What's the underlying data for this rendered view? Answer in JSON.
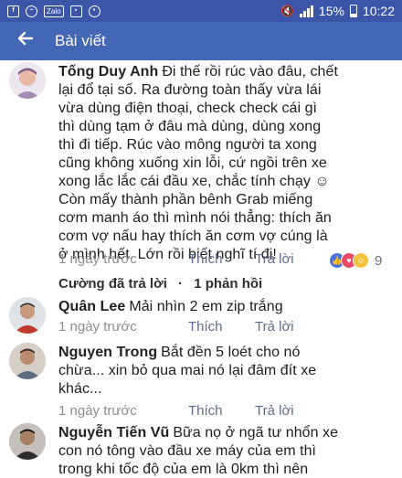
{
  "status": {
    "battery": "15%",
    "time": "10:22",
    "zalo": "Zalo"
  },
  "header": {
    "back_icon": "arrow-left-icon",
    "title": "Bài viết",
    "color": "#4467b5"
  },
  "comments": [
    {
      "author": "Tống Duy Anh",
      "lines": [
        "Đi thế rồi rúc vào đâu, chết",
        "lại đổ tại số. Ra đường toàn thấy vừa lái",
        "vừa dùng điện thoại, check check cái gì",
        "thì dùng tạm ở đâu mà dùng, dùng xong",
        "thì đi tiếp. Rúc vào mông người ta xong",
        "cũng không xuống xin lỗi, cứ ngồi trên xe",
        "xong lắc lắc cái đầu xe, chắc tính chạy ☺",
        "Còn mấy thành phần bênh Grab miếng",
        "cơm manh áo thì mình nói thẳng: thích ăn",
        "cơm vợ nấu hay thích ăn cơm vợ cúng là",
        "ở mình hết. Lớn rồi biết nghĩ tí đi!"
      ],
      "time": "1 ngày trước",
      "like": "Thích",
      "reply": "Trả lời",
      "reaction_count": "9"
    },
    {
      "author": "Quân Lee",
      "lines": [
        "Mải nhìn 2 em zip trắng"
      ],
      "time": "1 ngày trước",
      "like": "Thích",
      "reply": "Trả lời"
    },
    {
      "author": "Nguyen Trong",
      "lines": [
        "Bắt đền 5 loét cho nó",
        "chừa... xin bỏ qua mai nó lại đâm đít xe",
        "khác..."
      ],
      "time": "1 ngày trước",
      "like": "Thích",
      "reply": "Trả lời"
    },
    {
      "author": "Nguyễn Tiến Vũ",
      "lines": [
        "Bữa nọ ở ngã tư nhổn xe",
        "con nó tông vào đầu xe máy của em thì",
        "trong khi tốc độ của em là 0km thì nên"
      ]
    }
  ],
  "replies_summary": {
    "name": "Cường đã trả lời",
    "dot": "·",
    "count": "1 phản hồi"
  }
}
